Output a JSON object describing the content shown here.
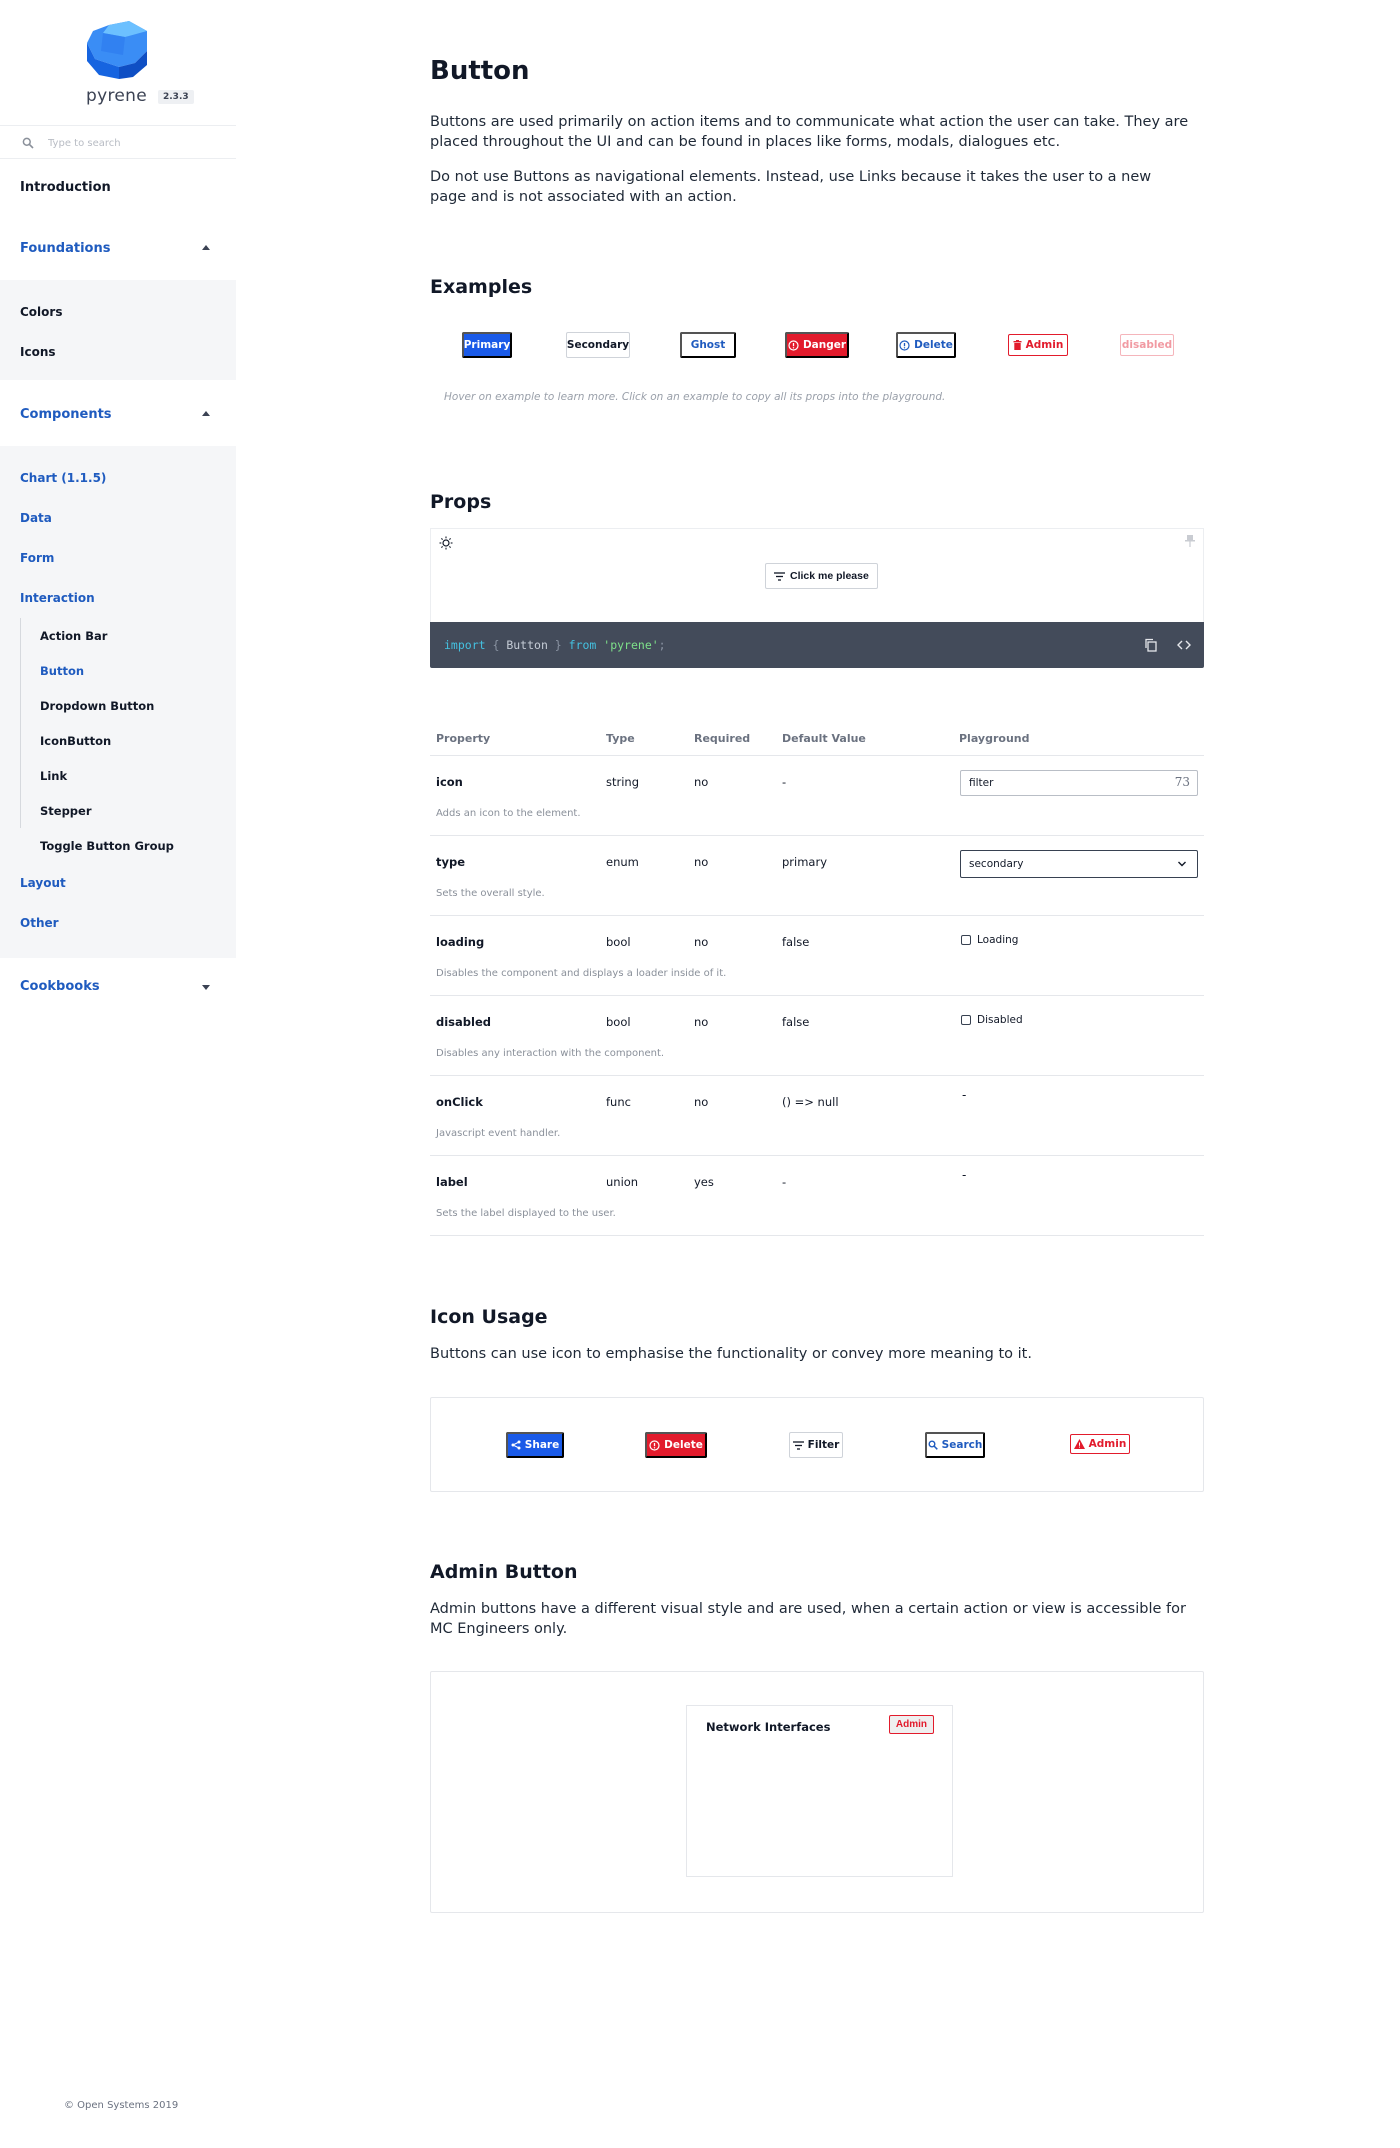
{
  "sidebar": {
    "logo_word": "pyrene",
    "version": "2.3.3",
    "search_placeholder": "Type to search",
    "introduction": "Introduction",
    "foundations": {
      "label": "Foundations",
      "items": [
        "Colors",
        "Icons"
      ]
    },
    "components": {
      "label": "Components",
      "items": [
        "Chart (1.1.5)",
        "Data",
        "Form",
        "Interaction"
      ],
      "interaction_sub": [
        "Action Bar",
        "Button",
        "Dropdown Button",
        "IconButton",
        "Link",
        "Stepper",
        "Toggle Button Group"
      ],
      "after": [
        "Layout",
        "Other"
      ]
    },
    "cookbooks": "Cookbooks",
    "footer": "© Open Systems 2019"
  },
  "main": {
    "title": "Button",
    "intro_1": "Buttons are used primarily on action items and to communicate what action the user can take. They are placed throughout the UI and can be found in places like forms, modals, dialogues etc.",
    "intro_2": "Do not use Buttons as navigational elements. Instead, use Links because it takes the user to a new page and is not associated with an action.",
    "examples": {
      "heading": "Examples",
      "buttons": [
        "Primary",
        "Secondary",
        "Ghost",
        "Danger",
        "Delete",
        "Admin",
        "disabled"
      ],
      "hint": "Hover on example to learn more. Click on an example to copy all its props into the playground."
    },
    "props": {
      "heading": "Props",
      "playground_button": "Click me please",
      "code": {
        "kw_import": "import",
        "open": " { ",
        "name": "Button",
        "close": " } ",
        "kw_from": "from",
        "str": " 'pyrene'",
        "semi": ";"
      },
      "columns": [
        "Property",
        "Type",
        "Required",
        "Default Value",
        "Playground"
      ],
      "rows": [
        {
          "name": "icon",
          "type": "string",
          "required": "no",
          "default": "-",
          "desc": "Adds an icon to the element.",
          "pg_value": "filter",
          "pg_extra": "73"
        },
        {
          "name": "type",
          "type": "enum",
          "required": "no",
          "default": "primary",
          "desc": "Sets the overall style.",
          "pg_value": "secondary"
        },
        {
          "name": "loading",
          "type": "bool",
          "required": "no",
          "default": "false",
          "desc": "Disables the component and displays a loader inside of it.",
          "pg_value": "Loading"
        },
        {
          "name": "disabled",
          "type": "bool",
          "required": "no",
          "default": "false",
          "desc": "Disables any interaction with the component.",
          "pg_value": "Disabled"
        },
        {
          "name": "onClick",
          "type": "func",
          "required": "no",
          "default": "() => null",
          "desc": "Javascript event handler.",
          "pg_value": "-"
        },
        {
          "name": "label",
          "type": "union",
          "required": "yes",
          "default": "-",
          "desc": "Sets the label displayed to the user.",
          "pg_value": "-"
        }
      ]
    },
    "icon_usage": {
      "heading": "Icon Usage",
      "text": "Buttons can use icon to emphasise the functionality or convey more meaning to it.",
      "buttons": [
        "Share",
        "Delete",
        "Filter",
        "Search",
        "Admin"
      ]
    },
    "admin_button": {
      "heading": "Admin Button",
      "text": "Admin buttons have a different visual style and are used, when a certain action or view is accessible for MC Engineers only.",
      "card_title": "Network Interfaces",
      "card_button": "Admin"
    }
  },
  "colors": {
    "brand_blue": "#1a5ae8",
    "nav_blue": "#1f5bbf",
    "danger_red": "#e21b2c",
    "code_bg": "#434b5a"
  }
}
